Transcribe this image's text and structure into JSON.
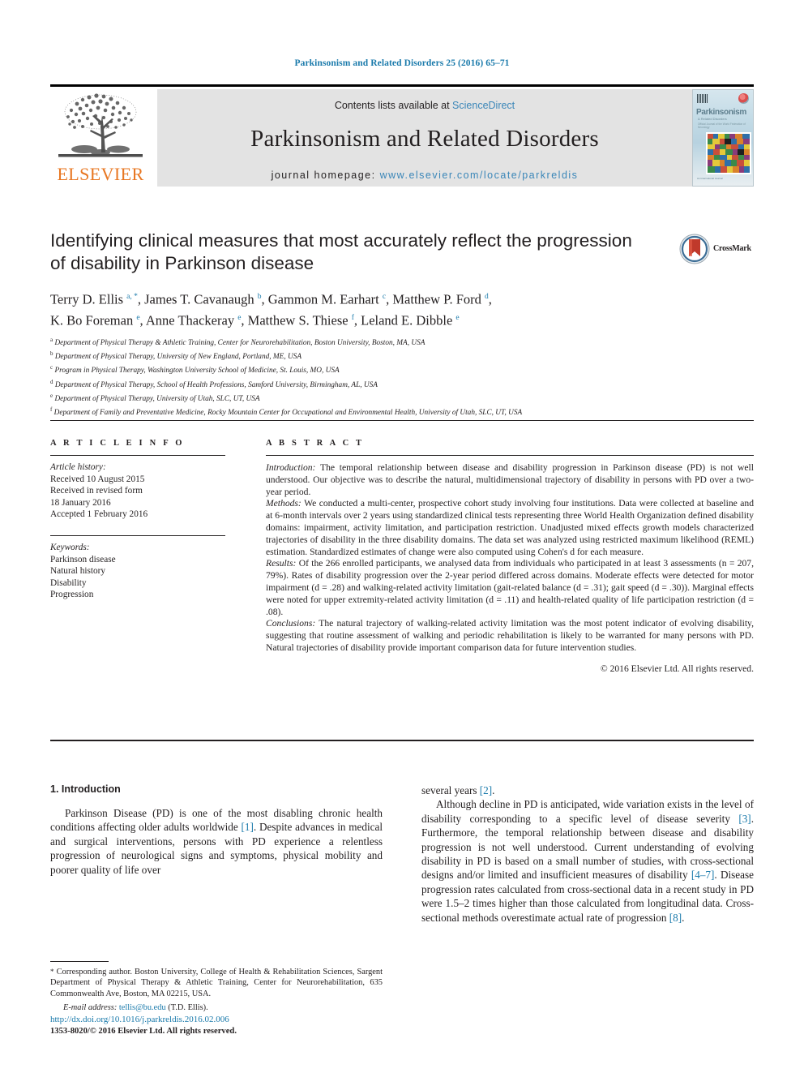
{
  "running_head": "Parkinsonism and Related Disorders 25 (2016) 65–71",
  "masthead": {
    "contents_prefix": "Contents lists available at ",
    "sciencedirect": "ScienceDirect",
    "journal_name": "Parkinsonism and Related Disorders",
    "homepage_label": "journal homepage: ",
    "homepage_url": "www.elsevier.com/locate/parkreldis",
    "publisher_name": "ELSEVIER",
    "cover": {
      "title": "Parkinsonism",
      "subtitle": "& Related Disorders",
      "subtitle2": "Official Journal of the World Federation of Neurology",
      "footer": "An International Journal"
    },
    "link_color": "#3a86b8"
  },
  "crossmark": {
    "label": "CrossMark"
  },
  "article": {
    "title": "Identifying clinical measures that most accurately reflect the progression of disability in Parkinson disease",
    "authors_line1": "Terry D. Ellis <sup>a, *</sup>, James T. Cavanaugh <sup>b</sup>, Gammon M. Earhart <sup>c</sup>, Matthew P. Ford <sup>d</sup>,",
    "authors_line2": "K. Bo Foreman <sup>e</sup>, Anne Thackeray <sup>e</sup>, Matthew S. Thiese <sup>f</sup>, Leland E. Dibble <sup>e</sup>",
    "affiliations": [
      {
        "mark": "a",
        "text": "Department of Physical Therapy & Athletic Training, Center for Neurorehabilitation, Boston University, Boston, MA, USA"
      },
      {
        "mark": "b",
        "text": "Department of Physical Therapy, University of New England, Portland, ME, USA"
      },
      {
        "mark": "c",
        "text": "Program in Physical Therapy, Washington University School of Medicine, St. Louis, MO, USA"
      },
      {
        "mark": "d",
        "text": "Department of Physical Therapy, School of Health Professions, Samford University, Birmingham, AL, USA"
      },
      {
        "mark": "e",
        "text": "Department of Physical Therapy, University of Utah, SLC, UT, USA"
      },
      {
        "mark": "f",
        "text": "Department of Family and Preventative Medicine, Rocky Mountain Center for Occupational and Environmental Health, University of Utah, SLC, UT, USA"
      }
    ]
  },
  "article_info": {
    "heading": "A R T I C L E   I N F O",
    "history_label": "Article history:",
    "history": [
      "Received 10 August 2015",
      "Received in revised form",
      "18 January 2016",
      "Accepted 1 February 2016"
    ],
    "keywords_label": "Keywords:",
    "keywords": [
      "Parkinson disease",
      "Natural history",
      "Disability",
      "Progression"
    ]
  },
  "abstract": {
    "heading": "A B S T R A C T",
    "sections": [
      {
        "label": "Introduction:",
        "text": " The temporal relationship between disease and disability progression in Parkinson disease (PD) is not well understood. Our objective was to describe the natural, multidimensional trajectory of disability in persons with PD over a two-year period."
      },
      {
        "label": "Methods:",
        "text": " We conducted a multi-center, prospective cohort study involving four institutions. Data were collected at baseline and at 6-month intervals over 2 years using standardized clinical tests representing three World Health Organization defined disability domains: impairment, activity limitation, and participation restriction. Unadjusted mixed effects growth models characterized trajectories of disability in the three disability domains. The data set was analyzed using restricted maximum likelihood (REML) estimation. Standardized estimates of change were also computed using Cohen's d for each measure."
      },
      {
        "label": "Results:",
        "text": " Of the 266 enrolled participants, we analysed data from individuals who participated in at least 3 assessments (n = 207, 79%). Rates of disability progression over the 2-year period differed across domains. Moderate effects were detected for motor impairment (d = .28) and walking-related activity limitation (gait-related balance (d = .31); gait speed (d = .30)). Marginal effects were noted for upper extremity-related activity limitation (d = .11) and health-related quality of life participation restriction (d = .08)."
      },
      {
        "label": "Conclusions:",
        "text": " The natural trajectory of walking-related activity limitation was the most potent indicator of evolving disability, suggesting that routine assessment of walking and periodic rehabilitation is likely to be warranted for many persons with PD. Natural trajectories of disability provide important comparison data for future intervention studies."
      }
    ],
    "copyright": "© 2016 Elsevier Ltd. All rights reserved."
  },
  "body": {
    "section_number_title": "1. Introduction",
    "left_paragraph_1_pre": "Parkinson Disease (PD) is one of the most disabling chronic health conditions affecting older adults worldwide ",
    "left_ref_1": "[1]",
    "left_paragraph_1_post": ". Despite advances in medical and surgical interventions, persons with PD experience a relentless progression of neurological signs and symptoms, physical mobility and poorer quality of life over",
    "right_continuation_pre": "several years ",
    "right_ref_2": "[2]",
    "right_continuation_post": ".",
    "right_paragraph_2_a": "Although decline in PD is anticipated, wide variation exists in the level of disability corresponding to a specific level of disease severity ",
    "right_ref_3": "[3]",
    "right_paragraph_2_b": ". Furthermore, the temporal relationship between disease and disability progression is not well understood. Current understanding of evolving disability in PD is based on a small number of studies, with cross-sectional designs and/or limited and insufficient measures of disability ",
    "right_ref_4": "[4–7]",
    "right_paragraph_2_c": ". Disease progression rates calculated from cross-sectional data in a recent study in PD were 1.5–2 times higher than those calculated from longitudinal data. Cross-sectional methods overestimate actual rate of progression ",
    "right_ref_5": "[8]",
    "right_paragraph_2_d": "."
  },
  "footnote": {
    "star": "*",
    "corresponding_text": " Corresponding author. Boston University, College of Health & Rehabilitation Sciences, Sargent Department of Physical Therapy & Athletic Training, Center for Neurorehabilitation, 635 Commonwealth Ave, Boston, MA 02215, USA.",
    "email_label": "E-mail address:",
    "email": "tellis@bu.edu",
    "email_attrib": " (T.D. Ellis)."
  },
  "publication": {
    "doi": "http://dx.doi.org/10.1016/j.parkreldis.2016.02.006",
    "issn_line": "1353-8020/© 2016 Elsevier Ltd. All rights reserved."
  }
}
